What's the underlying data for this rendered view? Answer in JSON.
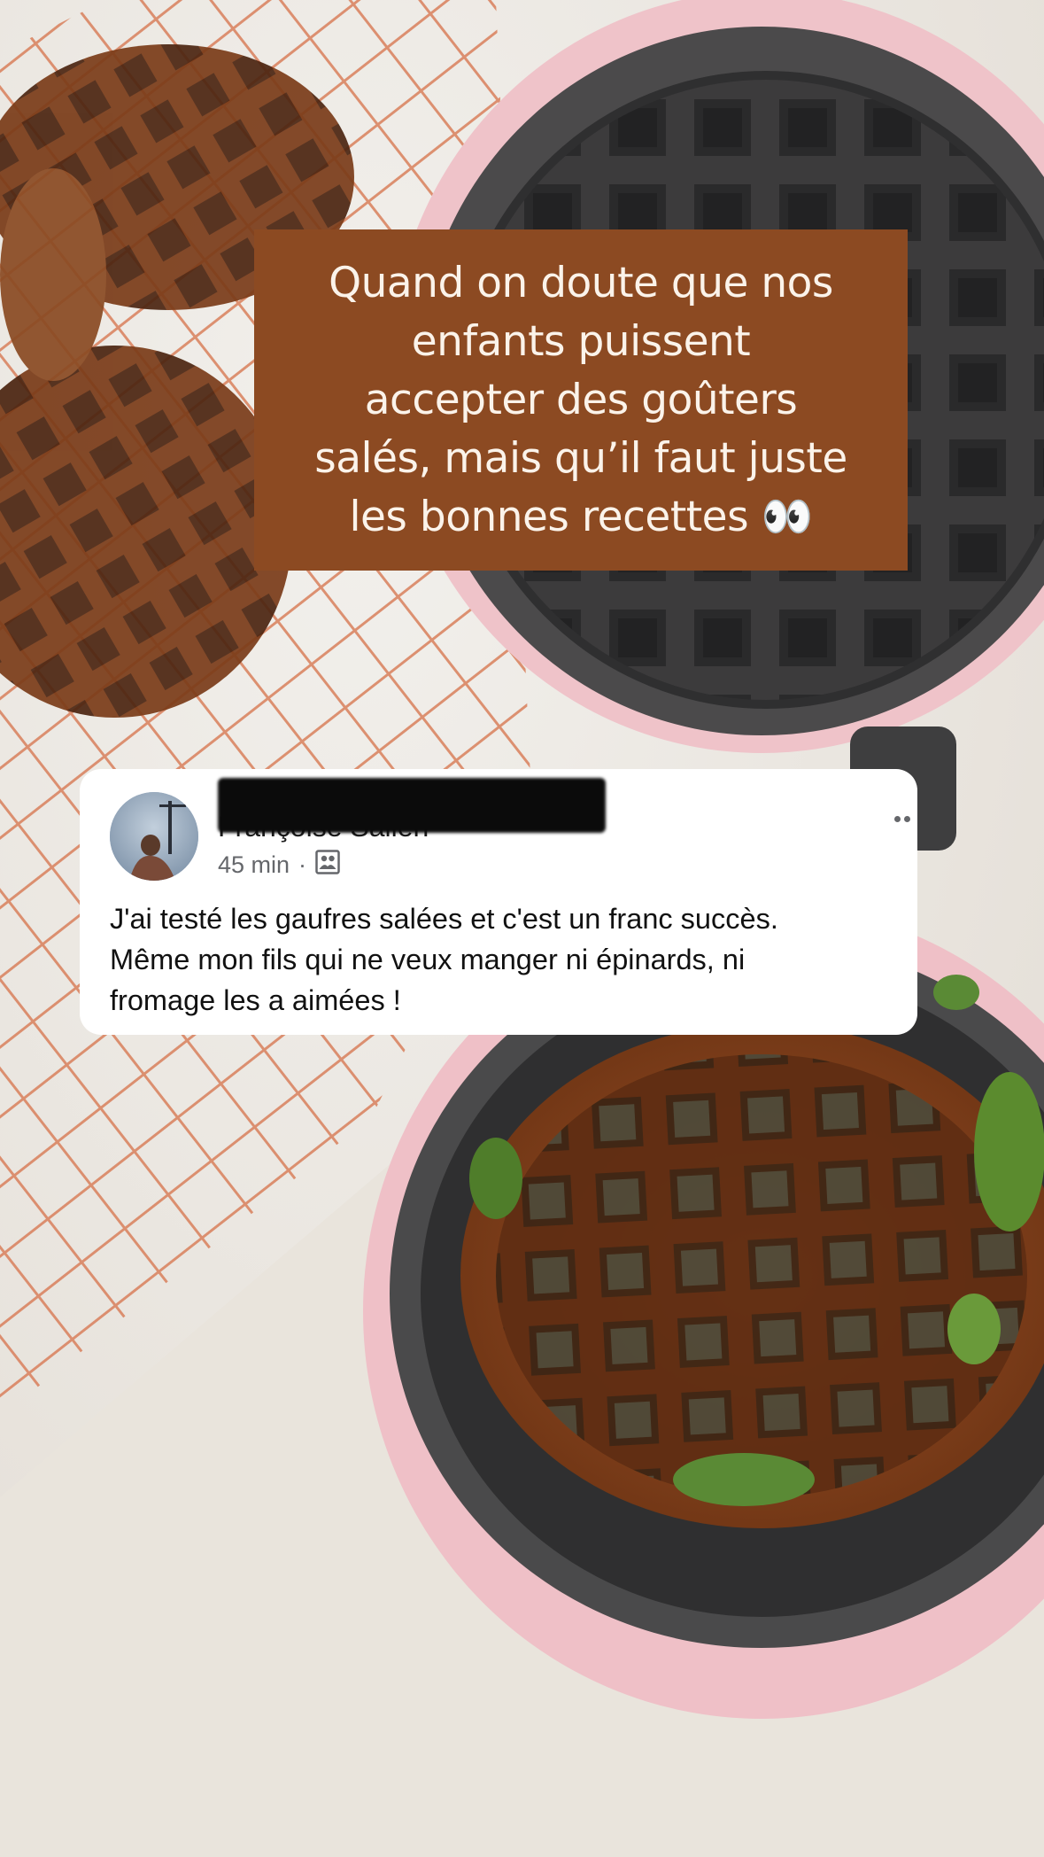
{
  "caption": {
    "lines": [
      "Quand on doute que nos",
      "enfants puissent",
      "accepter des goûters",
      "salés, mais qu’il faut juste",
      "les bonnes recettes 👀"
    ]
  },
  "comment": {
    "author": "Françoise Salien",
    "time": "45 min",
    "separator": "·",
    "privacy_icon": "friends-icon",
    "lines": [
      "J'ai testé les gaufres salées et c'est un franc succès.",
      "Même mon fils qui ne veux manger ni épinards, ni",
      "fromage les a aimées !"
    ],
    "more_icon": "more-options-icon"
  },
  "colors": {
    "caption_background": "#8c4a22",
    "caption_text": "#fbf3ea",
    "card_background": "#ffffff",
    "meta_text": "#65676b",
    "waffle_maker": "#efc0c7",
    "cooling_rack": "#d87a58",
    "waffle": "#8a4a22"
  }
}
